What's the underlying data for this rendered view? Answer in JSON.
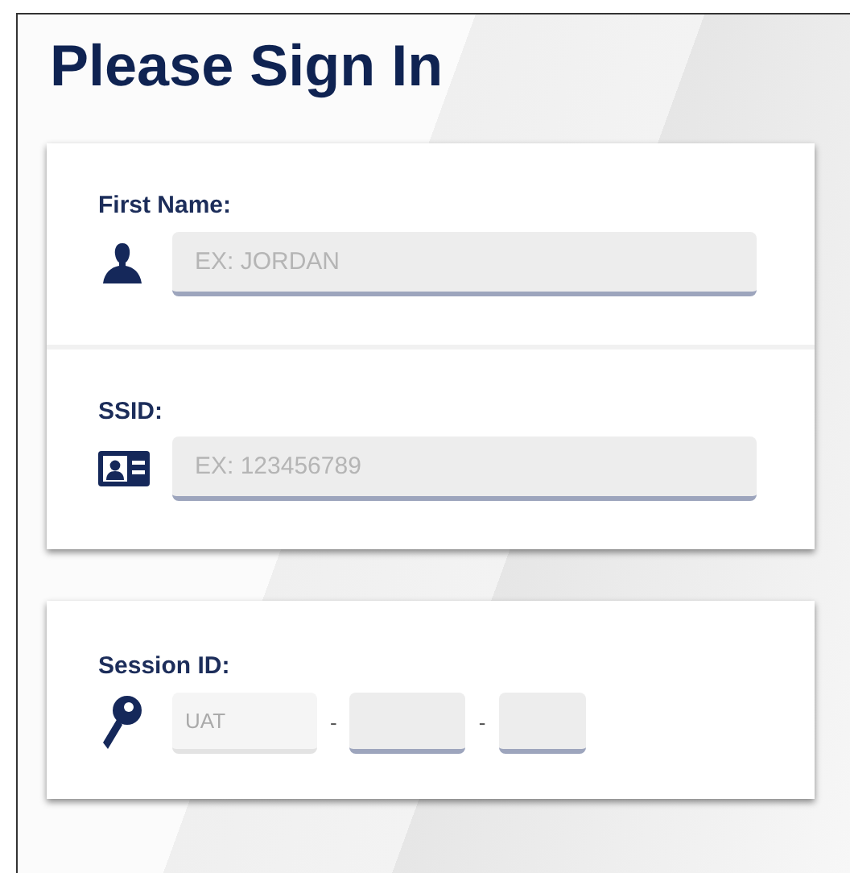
{
  "title": "Please Sign In",
  "cards": [
    {
      "fields": [
        {
          "label": "First Name:",
          "placeholder": "EX: JORDAN"
        },
        {
          "label": "SSID:",
          "placeholder": "EX: 123456789"
        }
      ]
    },
    {
      "session": {
        "label": "Session ID:",
        "segments": [
          {
            "value": "UAT",
            "disabled": true
          },
          {
            "separator": "-"
          },
          {
            "disabled": false
          },
          {
            "separator": "-"
          },
          {
            "disabled": false
          }
        ]
      }
    }
  ]
}
